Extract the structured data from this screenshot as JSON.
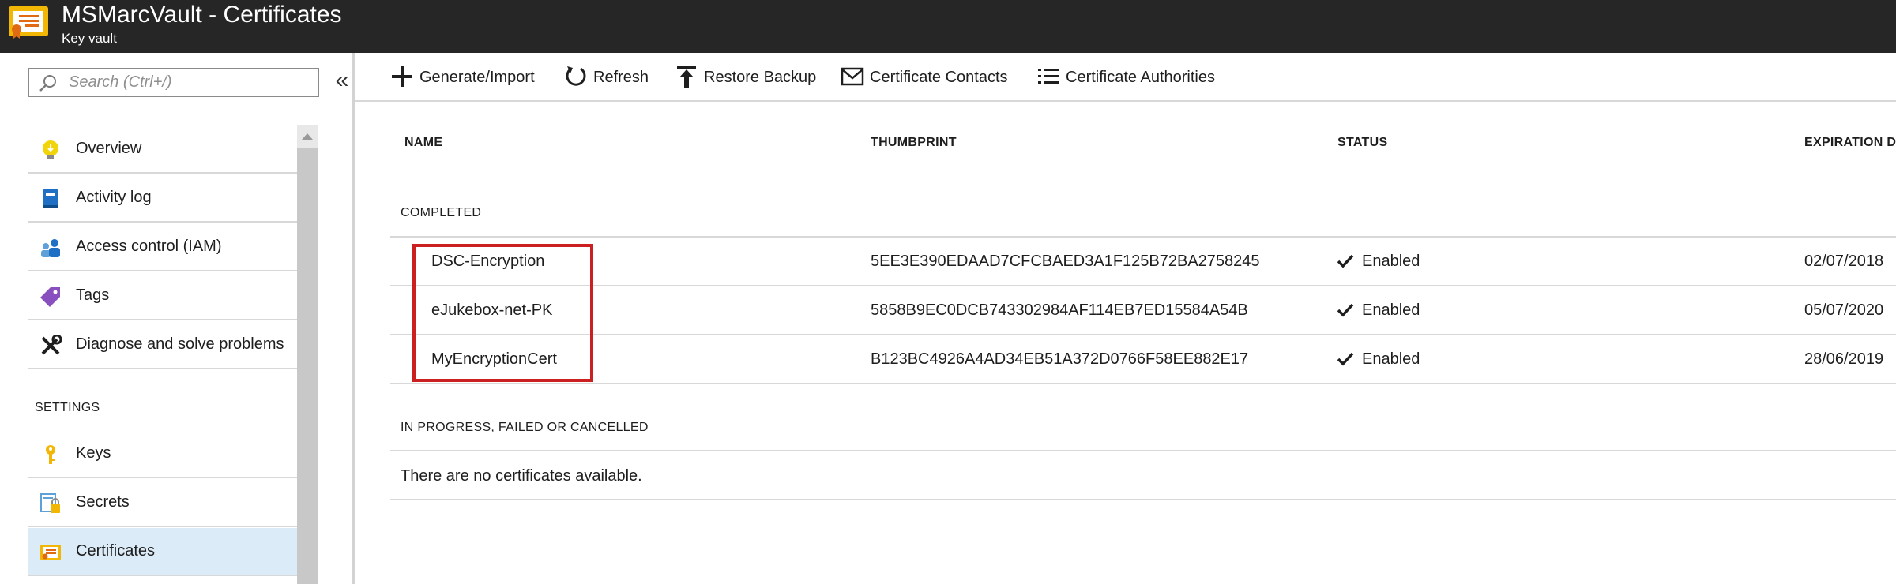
{
  "header": {
    "title": "MSMarcVault - Certificates",
    "subtitle": "Key vault"
  },
  "sidebar": {
    "search_placeholder": "Search (Ctrl+/)",
    "collapse_glyph": "«",
    "items": [
      {
        "label": "Overview",
        "icon": "overview-bulb-icon"
      },
      {
        "label": "Activity log",
        "icon": "activity-log-book-icon"
      },
      {
        "label": "Access control (IAM)",
        "icon": "users-icon"
      },
      {
        "label": "Tags",
        "icon": "tag-icon"
      },
      {
        "label": "Diagnose and solve problems",
        "icon": "wrench-icon"
      }
    ],
    "settings_label": "SETTINGS",
    "settings_items": [
      {
        "label": "Keys",
        "icon": "key-icon"
      },
      {
        "label": "Secrets",
        "icon": "secret-icon"
      },
      {
        "label": "Certificates",
        "icon": "certificate-icon",
        "selected": true
      }
    ]
  },
  "toolbar": {
    "generate_import": "Generate/Import",
    "refresh": "Refresh",
    "restore_backup": "Restore Backup",
    "certificate_contacts": "Certificate Contacts",
    "certificate_authorities": "Certificate Authorities"
  },
  "table": {
    "columns": [
      "NAME",
      "THUMBPRINT",
      "STATUS",
      "EXPIRATION D"
    ],
    "completed_label": "COMPLETED",
    "rows": [
      {
        "name": "DSC-Encryption",
        "thumbprint": "5EE3E390EDAAD7CFCBAED3A1F125B72BA2758245",
        "status": "Enabled",
        "expiration": "02/07/2018"
      },
      {
        "name": "eJukebox-net-PK",
        "thumbprint": "5858B9EC0DCB743302984AF114EB7ED15584A54B",
        "status": "Enabled",
        "expiration": "05/07/2020"
      },
      {
        "name": "MyEncryptionCert",
        "thumbprint": "B123BC4926A4AD34EB51A372D0766F58EE882E17",
        "status": "Enabled",
        "expiration": "28/06/2019"
      }
    ],
    "in_progress_label": "IN PROGRESS, FAILED OR CANCELLED",
    "empty_message": "There are no certificates available."
  },
  "colors": {
    "topbar": "#262626",
    "selected_nav": "#dcebf8",
    "highlight": "#cc1f1f",
    "certificate_icon": "#f2b705"
  }
}
